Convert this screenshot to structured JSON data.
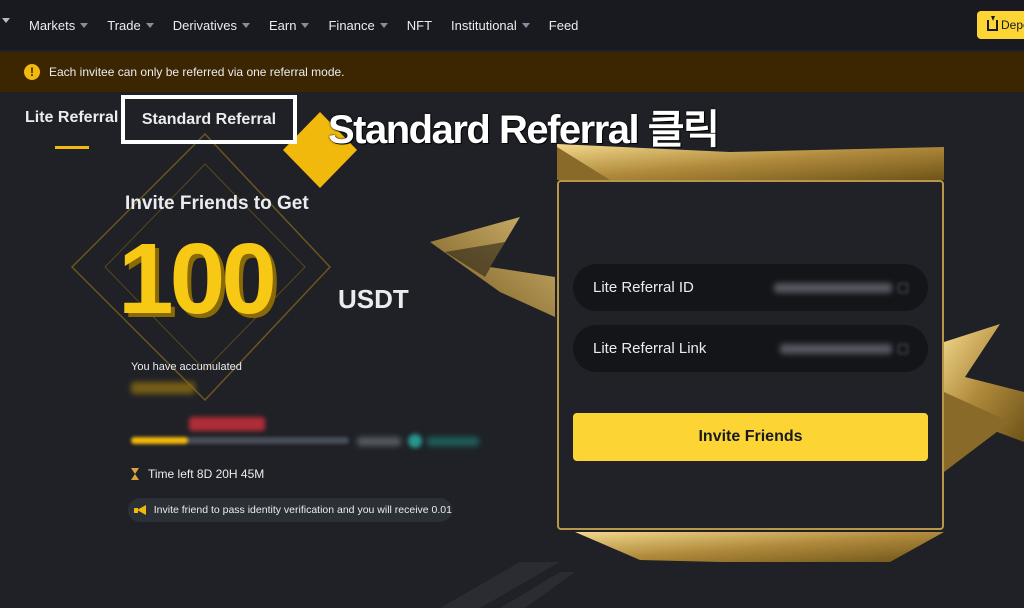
{
  "nav": {
    "items": [
      {
        "label": "Markets",
        "has_dropdown": true
      },
      {
        "label": "Trade",
        "has_dropdown": true
      },
      {
        "label": "Derivatives",
        "has_dropdown": true
      },
      {
        "label": "Earn",
        "has_dropdown": true
      },
      {
        "label": "Finance",
        "has_dropdown": true
      },
      {
        "label": "NFT",
        "has_dropdown": false
      },
      {
        "label": "Institutional",
        "has_dropdown": true
      },
      {
        "label": "Feed",
        "has_dropdown": false
      }
    ],
    "deposit_label": "Depo"
  },
  "notice": {
    "text": "Each invitee can only be referred via one referral mode.",
    "icon": "warning-icon"
  },
  "tabs": {
    "lite": "Lite Referral",
    "standard": "Standard Referral"
  },
  "callout": "Standard Referral 클릭",
  "promo": {
    "title": "Invite Friends to Get",
    "amount": "100",
    "unit": "USDT",
    "accumulated_label": "You have accumulated",
    "progress": 0.26,
    "time_left": "Time left 8D 20H 45M",
    "hint": "Invite friend to pass identity verification and you will receive 0.01"
  },
  "card": {
    "referral_id_label": "Lite Referral ID",
    "referral_link_label": "Lite Referral Link",
    "invite_button": "Invite Friends"
  },
  "colors": {
    "accent": "#fcd535",
    "gold": "#f0b90b",
    "background": "#1f2126",
    "nav_bg": "#181a20",
    "notice_bg": "#3c2601"
  }
}
